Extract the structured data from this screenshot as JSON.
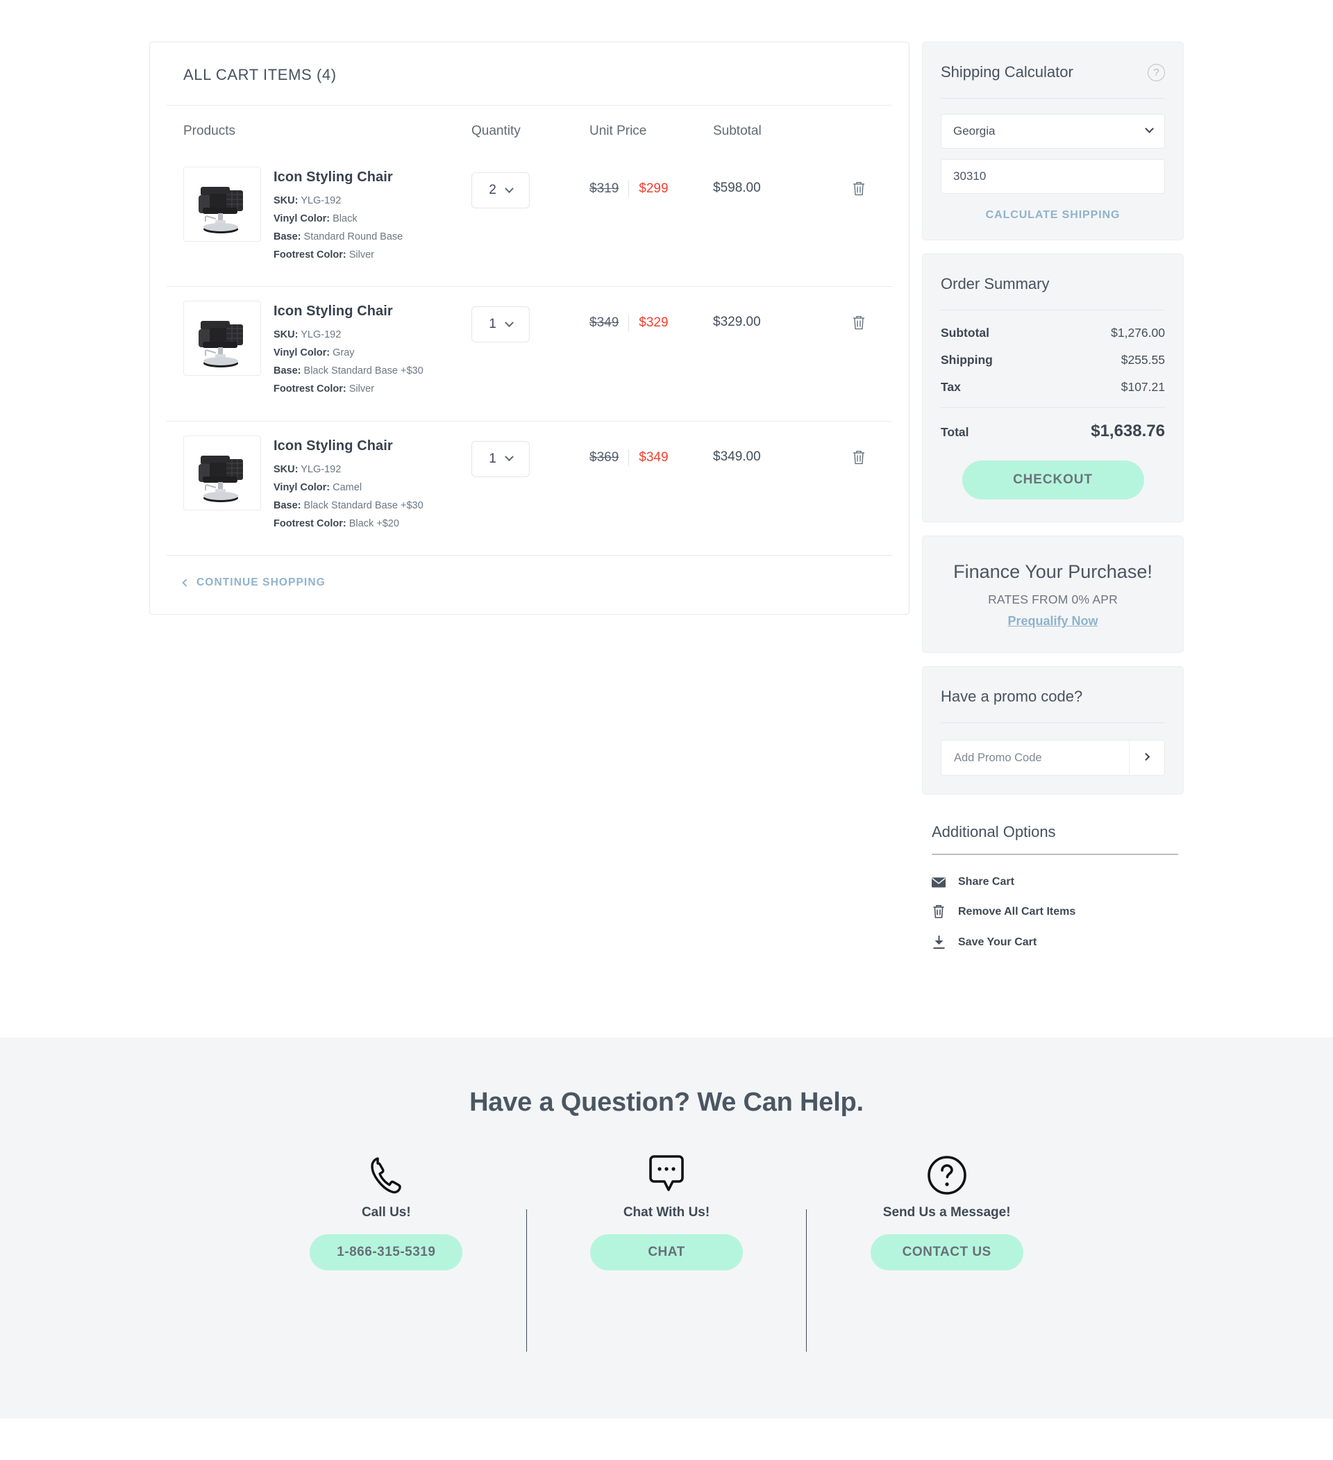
{
  "cart": {
    "title": "ALL CART ITEMS (4)",
    "columns": {
      "products": "Products",
      "quantity": "Quantity",
      "unit_price": "Unit Price",
      "subtotal": "Subtotal"
    },
    "items": [
      {
        "name": "Icon Styling Chair",
        "sku_label": "SKU:",
        "sku": "YLG-192",
        "vinyl_label": "Vinyl Color:",
        "vinyl": "Black",
        "base_label": "Base:",
        "base": "Standard Round Base",
        "footrest_label": "Footrest Color:",
        "footrest": "Silver",
        "quantity": "2",
        "old_price": "$319",
        "new_price": "$299",
        "subtotal": "$598.00",
        "remove_icon": "trash-icon"
      },
      {
        "name": "Icon Styling Chair",
        "sku_label": "SKU:",
        "sku": "YLG-192",
        "vinyl_label": "Vinyl Color:",
        "vinyl": "Gray",
        "base_label": "Base:",
        "base": "Black Standard Base +$30",
        "footrest_label": "Footrest Color:",
        "footrest": "Silver",
        "quantity": "1",
        "old_price": "$349",
        "new_price": "$329",
        "subtotal": "$329.00",
        "remove_icon": "trash-icon"
      },
      {
        "name": "Icon Styling Chair",
        "sku_label": "SKU:",
        "sku": "YLG-192",
        "vinyl_label": "Vinyl Color:",
        "vinyl": "Camel",
        "base_label": "Base:",
        "base": "Black Standard Base +$30",
        "footrest_label": "Footrest Color:",
        "footrest": "Black +$20",
        "quantity": "1",
        "old_price": "$369",
        "new_price": "$349",
        "subtotal": "$349.00",
        "remove_icon": "trash-icon"
      }
    ],
    "continue_shopping": "CONTINUE SHOPPING"
  },
  "shipping_calculator": {
    "title": "Shipping Calculator",
    "help_icon": "question-mark-icon",
    "state": "Georgia",
    "zip": "30310",
    "calculate_label": "CALCULATE SHIPPING"
  },
  "order_summary": {
    "title": "Order Summary",
    "rows": [
      {
        "label": "Subtotal",
        "value": "$1,276.00"
      },
      {
        "label": "Shipping",
        "value": "$255.55"
      },
      {
        "label": "Tax",
        "value": "$107.21"
      }
    ],
    "total_label": "Total",
    "total_value": "$1,638.76",
    "checkout_label": "CHECKOUT"
  },
  "finance": {
    "heading": "Finance Your Purchase!",
    "rates": "RATES FROM 0% APR",
    "link": "Prequalify Now"
  },
  "promo": {
    "title": "Have a promo code?",
    "placeholder": "Add Promo Code",
    "submit_icon": "chevron-right-icon"
  },
  "additional_options": {
    "title": "Additional Options",
    "items": [
      {
        "label": "Share Cart",
        "icon": "envelope-icon"
      },
      {
        "label": "Remove All Cart Items",
        "icon": "trash-icon"
      },
      {
        "label": "Save Your Cart",
        "icon": "download-icon"
      }
    ]
  },
  "help_footer": {
    "heading": "Have a Question? We Can Help.",
    "columns": [
      {
        "icon": "phone-icon",
        "label": "Call Us!",
        "button": "1-866-315-5319"
      },
      {
        "icon": "chat-bubble-icon",
        "label": "Chat With Us!",
        "button": "CHAT"
      },
      {
        "icon": "question-circle-icon",
        "label": "Send Us a Message!",
        "button": "CONTACT US"
      }
    ]
  },
  "colors": {
    "mint": "#b6f5dd",
    "sale_red": "#f4402f",
    "link_blue": "#8fb3cc",
    "panel_bg": "#f4f5f7"
  }
}
